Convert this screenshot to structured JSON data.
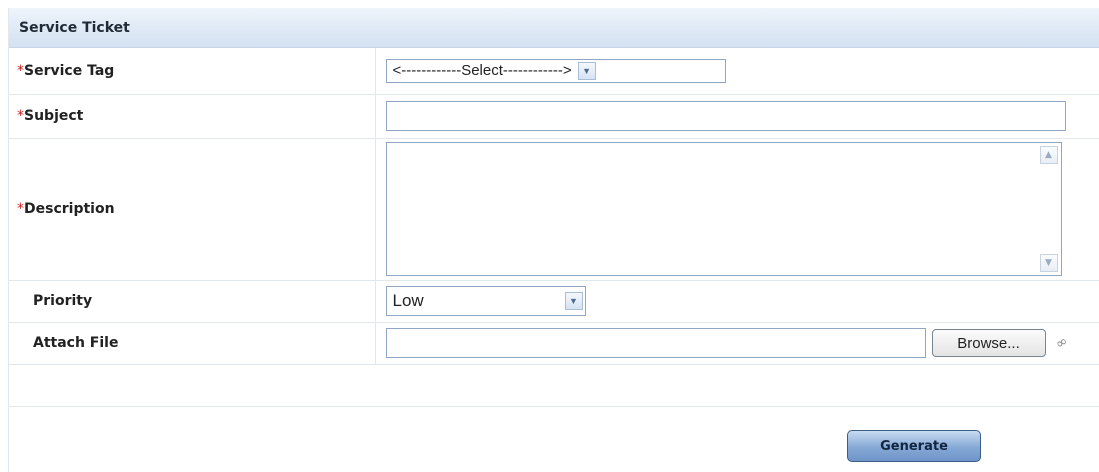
{
  "panel": {
    "title": "Service Ticket"
  },
  "form": {
    "required_marker": "*",
    "service_tag": {
      "label": "Service Tag",
      "selected": "<------------Select------------>"
    },
    "subject": {
      "label": "Subject",
      "value": ""
    },
    "description": {
      "label": "Description",
      "value": ""
    },
    "priority": {
      "label": "Priority",
      "selected": "Low"
    },
    "attach_file": {
      "label": "Attach File",
      "browse_label": "Browse..."
    }
  },
  "actions": {
    "generate_label": "Generate"
  },
  "icons": {
    "dropdown": "chevron-down-icon",
    "scroll_up": "scroll-up-icon",
    "scroll_down": "scroll-down-icon",
    "attachment": "paperclip-icon"
  },
  "colors": {
    "header_bg": "#d3e1f1",
    "required": "#cc2222",
    "border": "#8fa6c4",
    "button": "#85a9d6"
  }
}
